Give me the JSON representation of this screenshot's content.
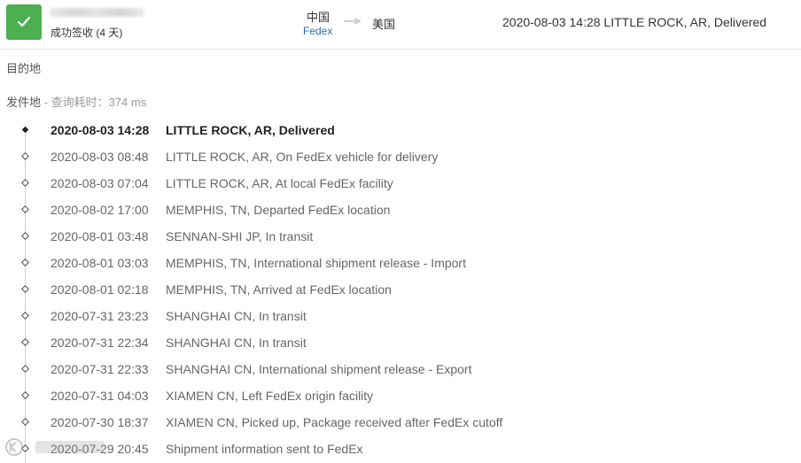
{
  "header": {
    "status": "成功签收 (4 天)",
    "origin": "中国",
    "carrier": "Fedex",
    "destination": "美国",
    "latest_event": "2020-08-03 14:28  LITTLE ROCK, AR, Delivered"
  },
  "info": {
    "destination_label": "目的地",
    "origin_label": "发件地",
    "separator": " - ",
    "query_time": "查询耗时：374 ms"
  },
  "events": [
    {
      "time": "2020-08-03 14:28",
      "desc": "LITTLE ROCK, AR, Delivered"
    },
    {
      "time": "2020-08-03 08:48",
      "desc": "LITTLE ROCK, AR, On FedEx vehicle for delivery"
    },
    {
      "time": "2020-08-03 07:04",
      "desc": "LITTLE ROCK, AR, At local FedEx facility"
    },
    {
      "time": "2020-08-02 17:00",
      "desc": "MEMPHIS, TN, Departed FedEx location"
    },
    {
      "time": "2020-08-01 03:48",
      "desc": "SENNAN-SHI JP, In transit"
    },
    {
      "time": "2020-08-01 03:03",
      "desc": "MEMPHIS, TN, International shipment release - Import"
    },
    {
      "time": "2020-08-01 02:18",
      "desc": "MEMPHIS, TN, Arrived at FedEx location"
    },
    {
      "time": "2020-07-31 23:23",
      "desc": "SHANGHAI CN, In transit"
    },
    {
      "time": "2020-07-31 22:34",
      "desc": "SHANGHAI CN, In transit"
    },
    {
      "time": "2020-07-31 22:33",
      "desc": "SHANGHAI CN, International shipment release - Export"
    },
    {
      "time": "2020-07-31 04:03",
      "desc": "XIAMEN CN, Left FedEx origin facility"
    },
    {
      "time": "2020-07-30 18:37",
      "desc": "XIAMEN CN, Picked up, Package received after FedEx cutoff"
    },
    {
      "time": "2020-07-29 20:45",
      "desc": "Shipment information sent to FedEx"
    }
  ],
  "icons": {
    "status": "checkmark-icon",
    "route_arrow": "arrow-right-icon",
    "marker_current": "diamond-filled-icon",
    "marker_past": "diamond-outline-icon"
  },
  "colors": {
    "success": "#4caf50",
    "carrier_link": "#2a6ab8"
  }
}
